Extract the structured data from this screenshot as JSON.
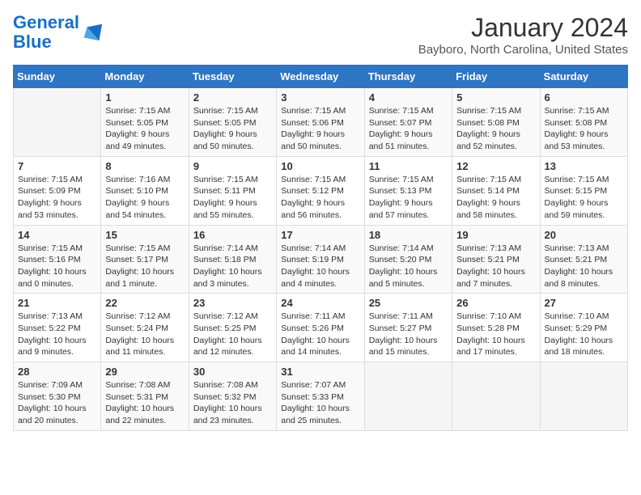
{
  "header": {
    "logo_text_general": "General",
    "logo_text_blue": "Blue",
    "title": "January 2024",
    "subtitle": "Bayboro, North Carolina, United States"
  },
  "columns": [
    "Sunday",
    "Monday",
    "Tuesday",
    "Wednesday",
    "Thursday",
    "Friday",
    "Saturday"
  ],
  "weeks": [
    [
      {
        "day": "",
        "info": ""
      },
      {
        "day": "1",
        "info": "Sunrise: 7:15 AM\nSunset: 5:05 PM\nDaylight: 9 hours\nand 49 minutes."
      },
      {
        "day": "2",
        "info": "Sunrise: 7:15 AM\nSunset: 5:05 PM\nDaylight: 9 hours\nand 50 minutes."
      },
      {
        "day": "3",
        "info": "Sunrise: 7:15 AM\nSunset: 5:06 PM\nDaylight: 9 hours\nand 50 minutes."
      },
      {
        "day": "4",
        "info": "Sunrise: 7:15 AM\nSunset: 5:07 PM\nDaylight: 9 hours\nand 51 minutes."
      },
      {
        "day": "5",
        "info": "Sunrise: 7:15 AM\nSunset: 5:08 PM\nDaylight: 9 hours\nand 52 minutes."
      },
      {
        "day": "6",
        "info": "Sunrise: 7:15 AM\nSunset: 5:08 PM\nDaylight: 9 hours\nand 53 minutes."
      }
    ],
    [
      {
        "day": "7",
        "info": "Sunrise: 7:15 AM\nSunset: 5:09 PM\nDaylight: 9 hours\nand 53 minutes."
      },
      {
        "day": "8",
        "info": "Sunrise: 7:16 AM\nSunset: 5:10 PM\nDaylight: 9 hours\nand 54 minutes."
      },
      {
        "day": "9",
        "info": "Sunrise: 7:15 AM\nSunset: 5:11 PM\nDaylight: 9 hours\nand 55 minutes."
      },
      {
        "day": "10",
        "info": "Sunrise: 7:15 AM\nSunset: 5:12 PM\nDaylight: 9 hours\nand 56 minutes."
      },
      {
        "day": "11",
        "info": "Sunrise: 7:15 AM\nSunset: 5:13 PM\nDaylight: 9 hours\nand 57 minutes."
      },
      {
        "day": "12",
        "info": "Sunrise: 7:15 AM\nSunset: 5:14 PM\nDaylight: 9 hours\nand 58 minutes."
      },
      {
        "day": "13",
        "info": "Sunrise: 7:15 AM\nSunset: 5:15 PM\nDaylight: 9 hours\nand 59 minutes."
      }
    ],
    [
      {
        "day": "14",
        "info": "Sunrise: 7:15 AM\nSunset: 5:16 PM\nDaylight: 10 hours\nand 0 minutes."
      },
      {
        "day": "15",
        "info": "Sunrise: 7:15 AM\nSunset: 5:17 PM\nDaylight: 10 hours\nand 1 minute."
      },
      {
        "day": "16",
        "info": "Sunrise: 7:14 AM\nSunset: 5:18 PM\nDaylight: 10 hours\nand 3 minutes."
      },
      {
        "day": "17",
        "info": "Sunrise: 7:14 AM\nSunset: 5:19 PM\nDaylight: 10 hours\nand 4 minutes."
      },
      {
        "day": "18",
        "info": "Sunrise: 7:14 AM\nSunset: 5:20 PM\nDaylight: 10 hours\nand 5 minutes."
      },
      {
        "day": "19",
        "info": "Sunrise: 7:13 AM\nSunset: 5:21 PM\nDaylight: 10 hours\nand 7 minutes."
      },
      {
        "day": "20",
        "info": "Sunrise: 7:13 AM\nSunset: 5:21 PM\nDaylight: 10 hours\nand 8 minutes."
      }
    ],
    [
      {
        "day": "21",
        "info": "Sunrise: 7:13 AM\nSunset: 5:22 PM\nDaylight: 10 hours\nand 9 minutes."
      },
      {
        "day": "22",
        "info": "Sunrise: 7:12 AM\nSunset: 5:24 PM\nDaylight: 10 hours\nand 11 minutes."
      },
      {
        "day": "23",
        "info": "Sunrise: 7:12 AM\nSunset: 5:25 PM\nDaylight: 10 hours\nand 12 minutes."
      },
      {
        "day": "24",
        "info": "Sunrise: 7:11 AM\nSunset: 5:26 PM\nDaylight: 10 hours\nand 14 minutes."
      },
      {
        "day": "25",
        "info": "Sunrise: 7:11 AM\nSunset: 5:27 PM\nDaylight: 10 hours\nand 15 minutes."
      },
      {
        "day": "26",
        "info": "Sunrise: 7:10 AM\nSunset: 5:28 PM\nDaylight: 10 hours\nand 17 minutes."
      },
      {
        "day": "27",
        "info": "Sunrise: 7:10 AM\nSunset: 5:29 PM\nDaylight: 10 hours\nand 18 minutes."
      }
    ],
    [
      {
        "day": "28",
        "info": "Sunrise: 7:09 AM\nSunset: 5:30 PM\nDaylight: 10 hours\nand 20 minutes."
      },
      {
        "day": "29",
        "info": "Sunrise: 7:08 AM\nSunset: 5:31 PM\nDaylight: 10 hours\nand 22 minutes."
      },
      {
        "day": "30",
        "info": "Sunrise: 7:08 AM\nSunset: 5:32 PM\nDaylight: 10 hours\nand 23 minutes."
      },
      {
        "day": "31",
        "info": "Sunrise: 7:07 AM\nSunset: 5:33 PM\nDaylight: 10 hours\nand 25 minutes."
      },
      {
        "day": "",
        "info": ""
      },
      {
        "day": "",
        "info": ""
      },
      {
        "day": "",
        "info": ""
      }
    ]
  ]
}
